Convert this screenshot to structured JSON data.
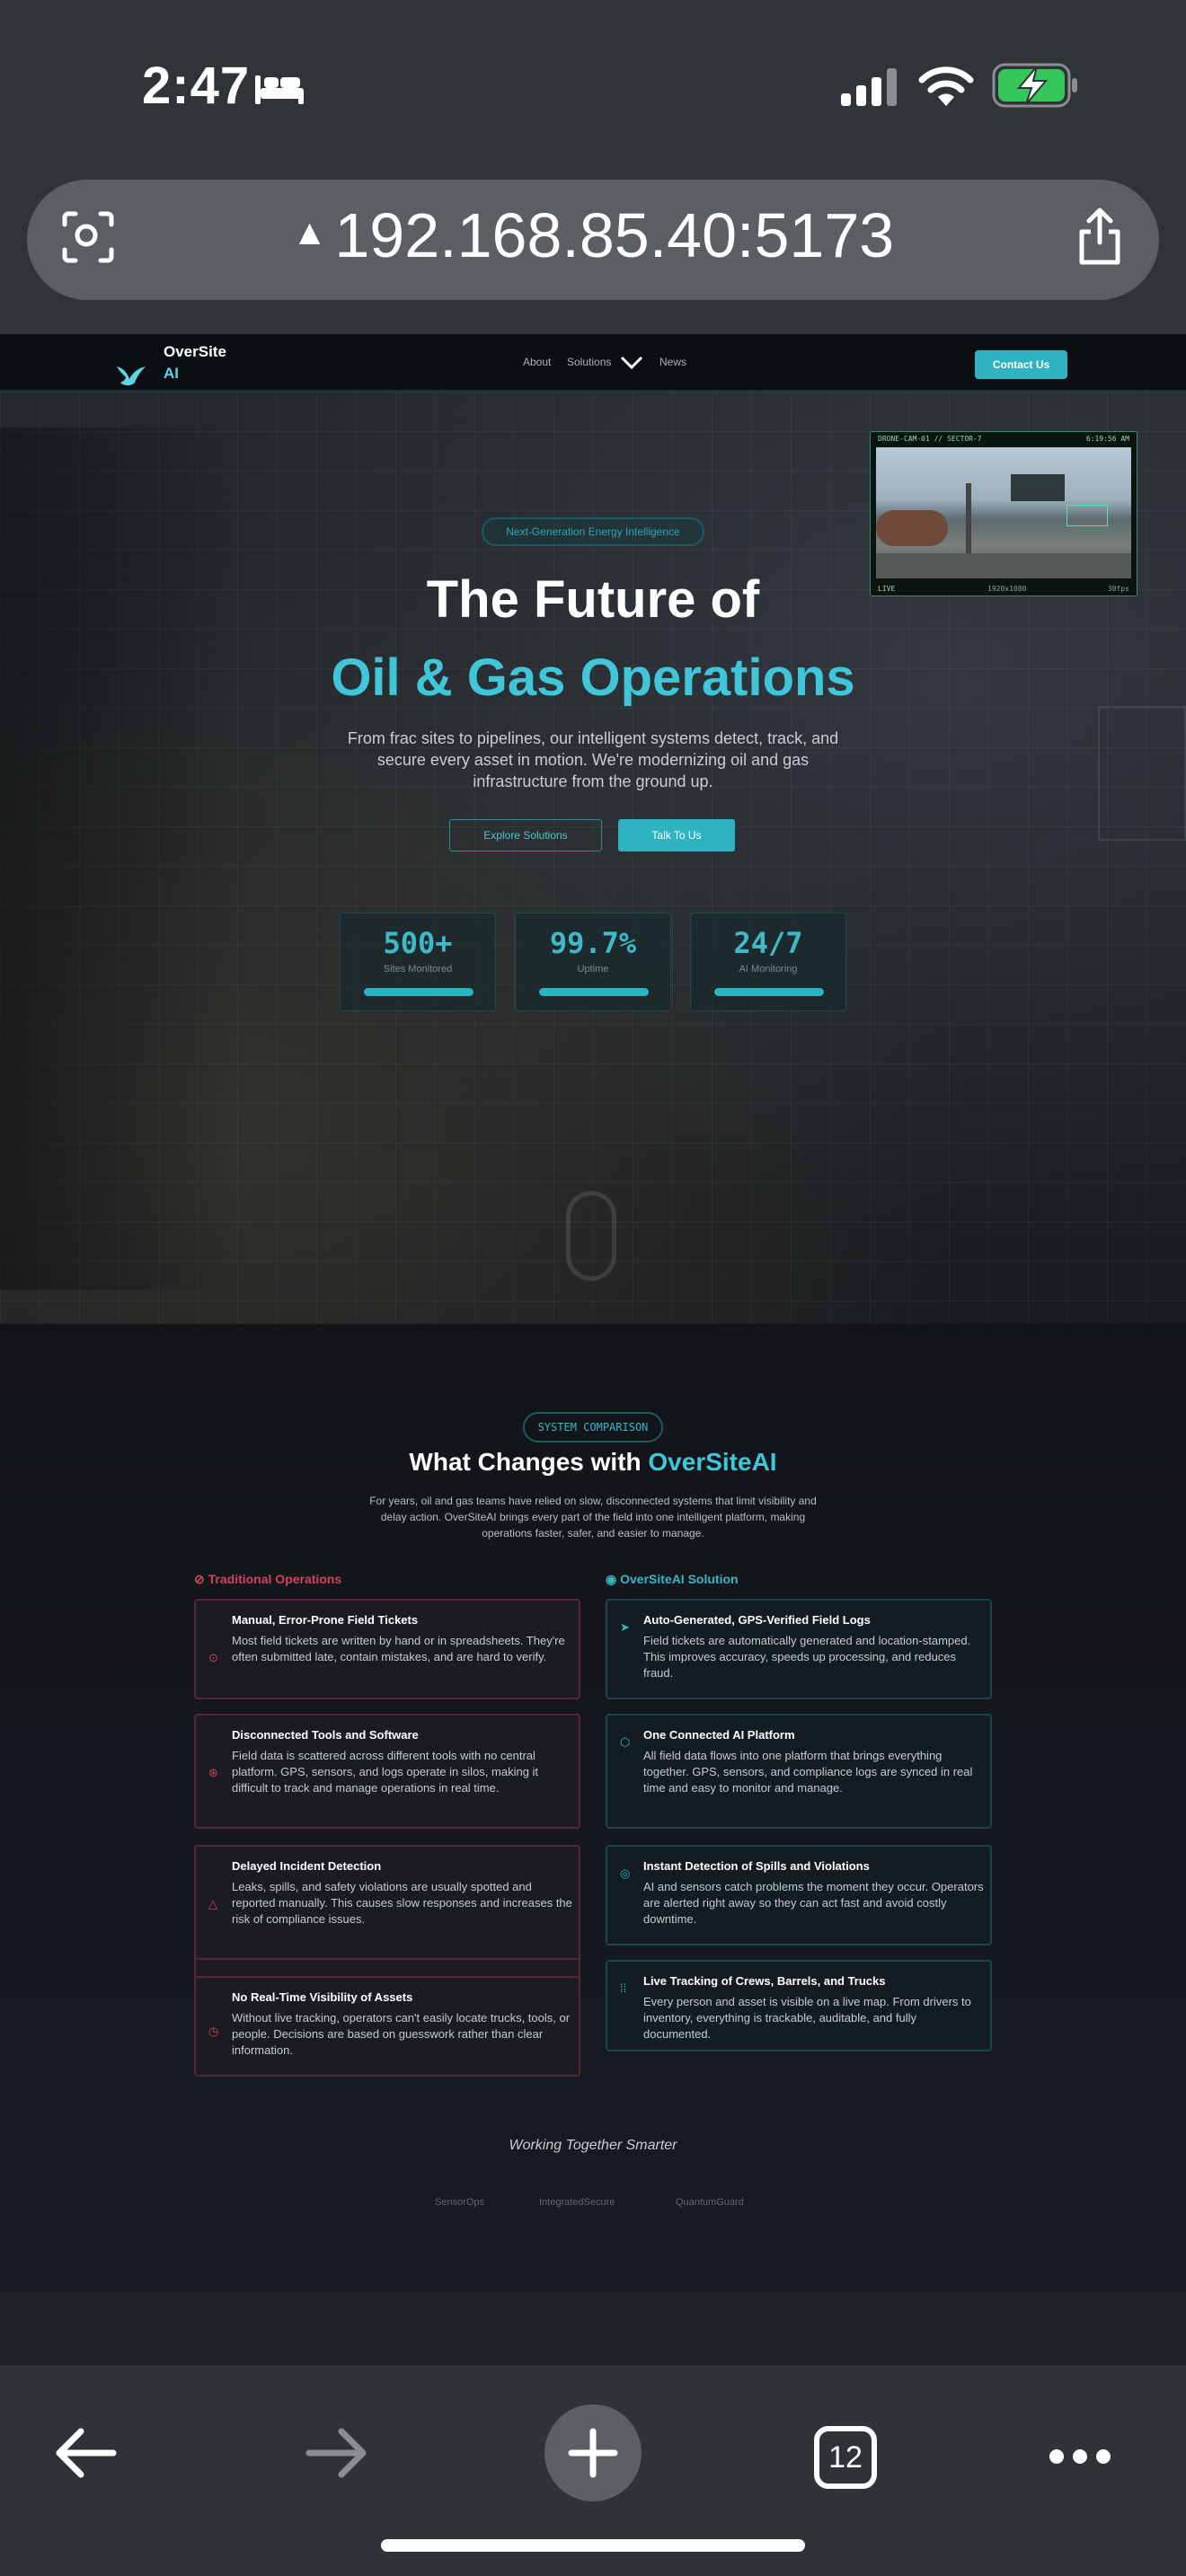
{
  "status": {
    "time": "2:47",
    "sleep_icon": "bed-icon",
    "battery_icon": "battery-charging-icon"
  },
  "browser": {
    "url": "192.168.85.40:5173",
    "tab_count": "12"
  },
  "nav": {
    "brand_line1": "OverSite",
    "brand_line2": "AI",
    "links": [
      "About",
      "Solutions",
      "News"
    ],
    "cta": "Contact Us"
  },
  "hero": {
    "badge": "Next-Generation Energy Intelligence",
    "title_line1": "The Future of",
    "title_line2": "Oil & Gas Operations",
    "lead": "From frac sites to pipelines, our intelligent systems detect, track, and secure every asset in motion. We're modernizing oil and gas infrastructure from the ground up.",
    "btn_explore": "Explore Solutions",
    "btn_talk": "Talk To Us",
    "stats": [
      {
        "value": "500+",
        "label": "Sites Monitored"
      },
      {
        "value": "99.7%",
        "label": "Uptime"
      },
      {
        "value": "24/7",
        "label": "AI Monitoring"
      }
    ],
    "camera": {
      "header": "DRONE-CAM-01 // SECTOR-7",
      "time": "6:19:56 AM",
      "live": "LIVE",
      "resolution": "1920x1080",
      "fps": "30fps"
    }
  },
  "comparison": {
    "badge": "SYSTEM COMPARISON",
    "title_prefix": "What Changes with ",
    "title_highlight": "OverSiteAI",
    "description": "For years, oil and gas teams have relied on slow, disconnected systems that limit visibility and delay action. OverSiteAI brings every part of the field into one intelligent platform, making operations faster, safer, and easier to manage.",
    "traditional_heading": "Traditional Operations",
    "solution_heading": "OverSiteAI Solution",
    "traditional": [
      {
        "title": "Manual, Error-Prone Field Tickets",
        "desc": "Most field tickets are written by hand or in spreadsheets. They're often submitted late, contain mistakes, and are hard to verify."
      },
      {
        "title": "Disconnected Tools and Software",
        "desc": "Field data is scattered across different tools with no central platform. GPS, sensors, and logs operate in silos, making it difficult to track and manage operations in real time."
      },
      {
        "title": "Delayed Incident Detection",
        "desc": "Leaks, spills, and safety violations are usually spotted and reported manually. This causes slow responses and increases the risk of compliance issues."
      },
      {
        "title": "No Real-Time Visibility of Assets",
        "desc": "Without live tracking, operators can't easily locate trucks, tools, or people. Decisions are based on guesswork rather than clear information."
      }
    ],
    "solution": [
      {
        "title": "Auto-Generated, GPS-Verified Field Logs",
        "desc": "Field tickets are automatically generated and location-stamped. This improves accuracy, speeds up processing, and reduces fraud."
      },
      {
        "title": "One Connected AI Platform",
        "desc": "All field data flows into one platform that brings everything together. GPS, sensors, and compliance logs are synced in real time and easy to monitor and manage."
      },
      {
        "title": "Instant Detection of Spills and Violations",
        "desc": "AI and sensors catch problems the moment they occur. Operators are alerted right away so they can act fast and avoid costly downtime."
      },
      {
        "title": "Live Tracking of Crews, Barrels, and Trucks",
        "desc": "Every person and asset is visible on a live map. From drivers to inventory, everything is trackable, auditable, and fully documented."
      }
    ],
    "together": "Working Together Smarter",
    "partners": [
      "SensorOps",
      "IntegratedSecure",
      "QuantumGuard"
    ]
  }
}
